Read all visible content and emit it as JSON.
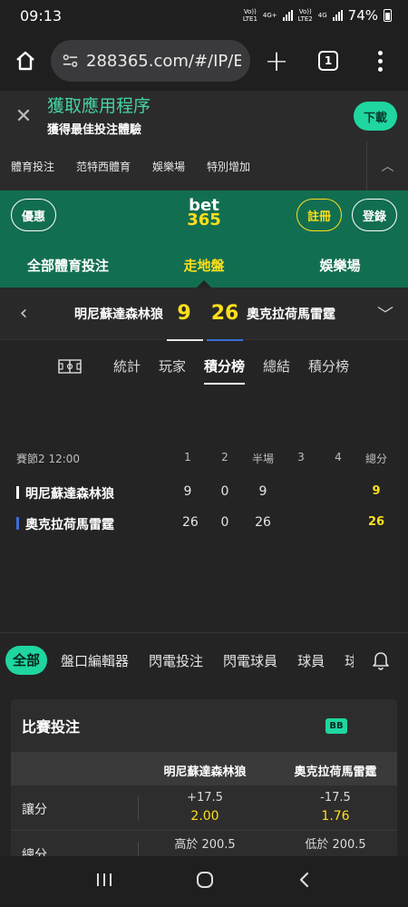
{
  "status": {
    "time": "09:13",
    "sim1_top": "Vo))",
    "sim1_bottom": "LTE1",
    "sim1_net": "4G+",
    "sim2_top": "Vo))",
    "sim2_bottom": "LTE2",
    "sim2_net": "4G",
    "battery": "74%"
  },
  "browser": {
    "url": "288365.com/#/IP/E\\",
    "tab_count": "1"
  },
  "app_banner": {
    "title": "獲取應用程序",
    "subtitle": "獲得最佳投注體驗",
    "download": "下載"
  },
  "top_nav": [
    "體育投注",
    "范特西體育",
    "娛樂場",
    "特別增加"
  ],
  "brand": {
    "promo": "優惠",
    "logo_top": "bet",
    "logo_bottom": "365",
    "join": "註冊",
    "login": "登錄"
  },
  "main_nav": {
    "sports": "全部體育投注",
    "inplay": "走地盤",
    "casino": "娛樂場"
  },
  "match": {
    "home": "明尼蘇達森林狼",
    "home_score": "9",
    "away_score": "26",
    "away": "奧克拉荷馬雷霆"
  },
  "stat_tabs": {
    "stats": "統計",
    "players": "玩家",
    "standings": "積分榜",
    "summary": "總結",
    "table": "積分榜"
  },
  "scoreboard": {
    "game": "賽節2",
    "clock": "12:00",
    "headers": [
      "1",
      "2",
      "半場",
      "3",
      "4",
      "總分"
    ],
    "home": {
      "name": "明尼蘇達森林狼",
      "q1": "9",
      "q2": "0",
      "half": "9",
      "total": "9"
    },
    "away": {
      "name": "奧克拉荷馬雷霆",
      "q1": "26",
      "q2": "0",
      "half": "26",
      "total": "26"
    }
  },
  "filters": [
    "全部",
    "盤口編輯器",
    "閃電投注",
    "閃電球員",
    "球員",
    "球|"
  ],
  "market": {
    "title": "比賽投注",
    "badge": "BB",
    "col_home": "明尼蘇達森林狼",
    "col_away": "奧克拉荷馬雷霆",
    "spread_label": "讓分",
    "spread_home_line": "+17.5",
    "spread_home_price": "2.00",
    "spread_away_line": "-17.5",
    "spread_away_price": "1.76",
    "total_label": "總分",
    "total_over": "高於 200.5",
    "total_under": "低於 200.5"
  },
  "colors": {
    "brand_green": "#126e51",
    "accent_yellow": "#ffdf1b",
    "accent_teal": "#1fd6a0",
    "away_blue": "#3a6fd8"
  }
}
